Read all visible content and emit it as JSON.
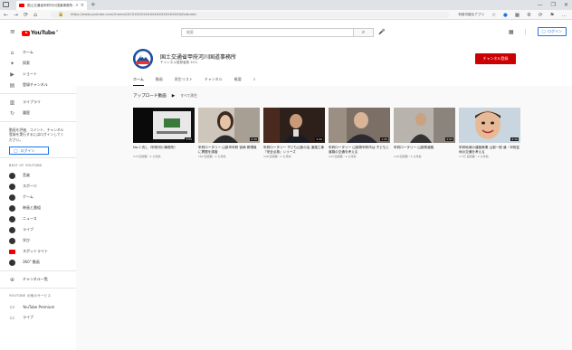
{
  "browser": {
    "tab_title": "国土交通省甲府河川国道事務所 - YouTube",
    "tab_close": "×",
    "new_tab": "+",
    "window_min": "—",
    "window_max": "❐",
    "window_close": "✕",
    "back": "←",
    "forward": "→",
    "reload": "⟳",
    "home": "⌂",
    "url": "https://www.youtube.com/channel/UCXXXXXXXXXXXXXXXXXXXXXX/featured",
    "extension_label": "利用可能なアプリ",
    "ext_icon_1": "☆",
    "ext_icon_2": "●",
    "ext_icon_3": "▦",
    "ext_icon_4": "⚙",
    "ext_icon_5": "⟳",
    "ext_icon_6": "⚑",
    "ext_icon_7": "…"
  },
  "header": {
    "logo_text": "YouTube",
    "logo_region": "JP",
    "search_placeholder": "検索",
    "search_icon": "⌕",
    "mic_icon": "🎤",
    "apps_icon": "▦",
    "more_icon": "⋮",
    "login_label": "ログイン"
  },
  "sidebar": {
    "primary": [
      {
        "icon": "⌂",
        "label": "ホーム"
      },
      {
        "icon": "✦",
        "label": "探索"
      },
      {
        "icon": "▶",
        "label": "ショート"
      },
      {
        "icon": "▤",
        "label": "登録チャンネル"
      }
    ],
    "secondary": [
      {
        "icon": "▥",
        "label": "ライブラリ"
      },
      {
        "icon": "↻",
        "label": "履歴"
      }
    ],
    "login_prompt": "動画を評価、コメント、チャンネル登録を実行するにはログインしてください。",
    "login_label": "ログイン",
    "best_heading": "BEST OF YOUTUBE",
    "best": [
      {
        "label": "音楽"
      },
      {
        "label": "スポーツ"
      },
      {
        "label": "ゲーム"
      },
      {
        "label": "映画と番組"
      },
      {
        "label": "ニュース"
      },
      {
        "label": "ライブ"
      },
      {
        "label": "学び"
      },
      {
        "label": "スポットライト"
      },
      {
        "label": "360° 動画"
      }
    ],
    "browse_channels": "チャンネル一覧",
    "more_heading": "YOUTUBE の他のサービス",
    "more": [
      {
        "icon": "▭",
        "label": "YouTube Premium"
      },
      {
        "icon": "▭",
        "label": "ライブ"
      }
    ]
  },
  "channel": {
    "name": "国土交通省甲府河川国道事務所",
    "subscribers": "チャンネル登録者数 45人",
    "subscribe_label": "チャンネル登録",
    "tabs": [
      "ホーム",
      "動画",
      "再生リスト",
      "チャンネル",
      "概要"
    ],
    "search_icon": "⌕",
    "section_title": "アップロード動画",
    "play_all_icon": "▶",
    "play_all": "すべて再生",
    "colors": {
      "subscribe": "#cc0000",
      "avatar": "#1a4fa0"
    }
  },
  "videos": [
    {
      "title": "No.1 流し（甲府河川事務所）",
      "meta": "176 回視聴・2 か月前",
      "duration": "1:52"
    },
    {
      "title": "甲府ロータリー 山梨市甲府 宮崎 県環境に問題を調査",
      "meta": "162 回視聴・2 か月前",
      "duration": "2:30"
    },
    {
      "title": "甲府ロータリー 子ども山梨の会 道路工事『安全点検』シリーズ",
      "meta": "108 回視聴・2 か月前",
      "duration": "3:20"
    },
    {
      "title": "甲府ロータリー 山梨県甲府市は 子どもと道路の交通を考える",
      "meta": "103 回視聴・2 か月前",
      "duration": "1:45"
    },
    {
      "title": "甲府ロータリー 山梨県道路",
      "meta": "136 回視聴・2 か月前",
      "duration": "2:05"
    },
    {
      "title": "甲府地域の道路事業 山梨一般 道・甲府盆地の交通を考える",
      "meta": "1.7万 回視聴・2 か月前",
      "duration": "4:10"
    }
  ]
}
